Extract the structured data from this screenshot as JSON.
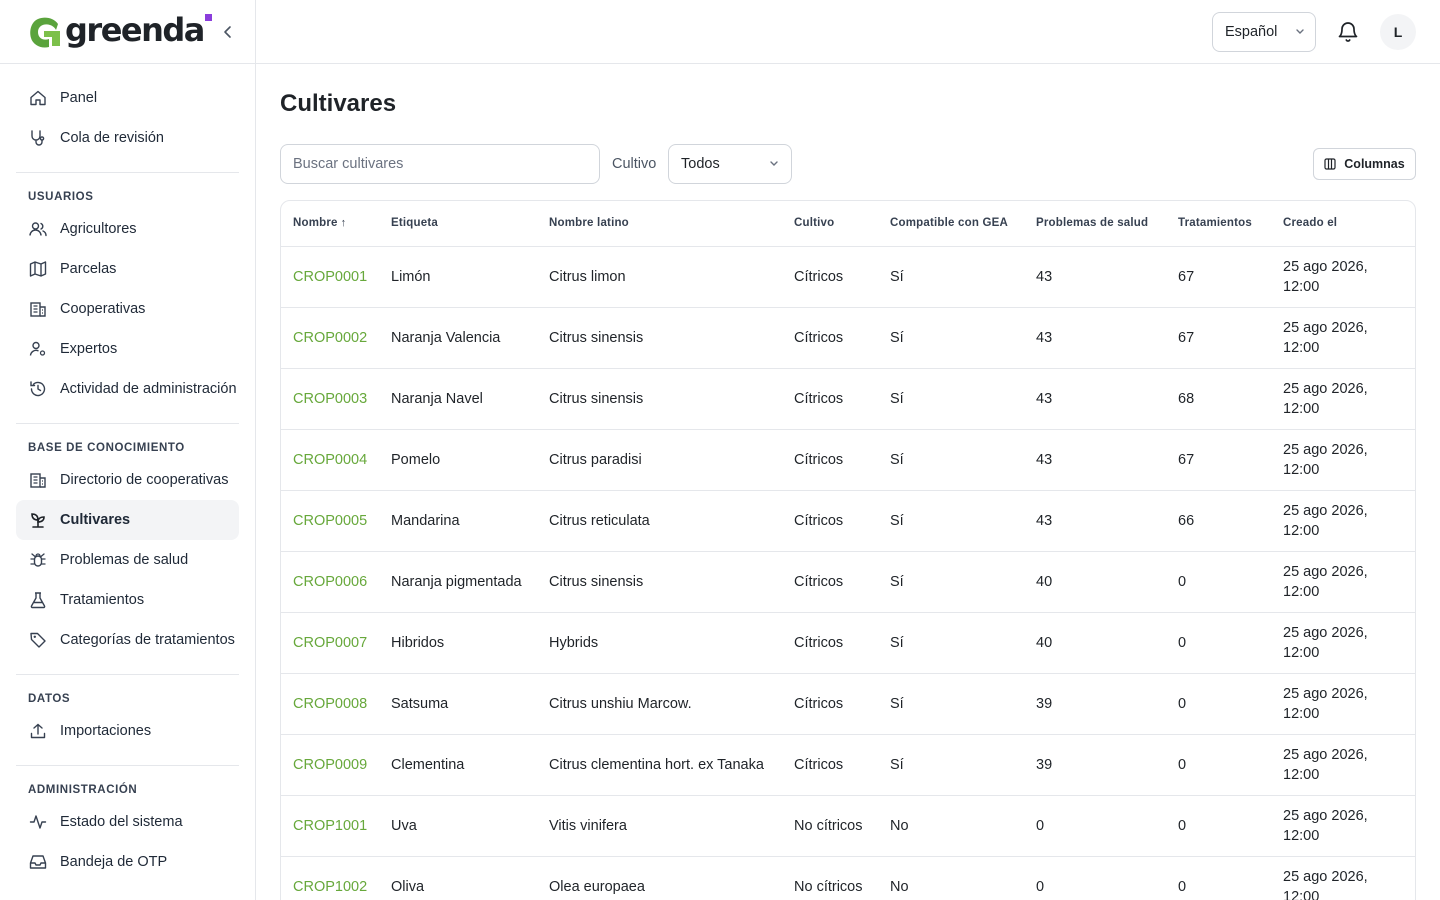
{
  "brand": {
    "name": "greenda",
    "accent": "#8b3ddc",
    "logo_green": "#5aa33c"
  },
  "sidebar": {
    "top_items": [
      {
        "label": "Panel",
        "icon": "home-icon"
      },
      {
        "label": "Cola de revisión",
        "icon": "stethoscope-icon"
      }
    ],
    "groups": [
      {
        "title": "USUARIOS",
        "items": [
          {
            "label": "Agricultores",
            "icon": "users-icon"
          },
          {
            "label": "Parcelas",
            "icon": "map-icon"
          },
          {
            "label": "Cooperativas",
            "icon": "building-icon"
          },
          {
            "label": "Expertos",
            "icon": "user-cog-icon"
          },
          {
            "label": "Actividad de administración",
            "icon": "history-icon"
          }
        ]
      },
      {
        "title": "BASE DE CONOCIMIENTO",
        "items": [
          {
            "label": "Directorio de cooperativas",
            "icon": "building-icon"
          },
          {
            "label": "Cultivares",
            "icon": "sprout-icon",
            "active": true
          },
          {
            "label": "Problemas de salud",
            "icon": "bug-icon"
          },
          {
            "label": "Tratamientos",
            "icon": "flask-icon"
          },
          {
            "label": "Categorías de tratamientos",
            "icon": "tag-icon"
          }
        ]
      },
      {
        "title": "DATOS",
        "items": [
          {
            "label": "Importaciones",
            "icon": "upload-icon"
          }
        ]
      },
      {
        "title": "ADMINISTRACIÓN",
        "items": [
          {
            "label": "Estado del sistema",
            "icon": "activity-icon"
          },
          {
            "label": "Bandeja de OTP",
            "icon": "inbox-icon"
          }
        ]
      }
    ]
  },
  "header": {
    "language": "Español",
    "avatar_initial": "L"
  },
  "page": {
    "title": "Cultivares",
    "search_placeholder": "Buscar cultivares",
    "filter_label": "Cultivo",
    "filter_value": "Todos",
    "columns_button": "Columnas"
  },
  "table": {
    "columns": [
      "Nombre",
      "Etiqueta",
      "Nombre latino",
      "Cultivo",
      "Compatible con GEA",
      "Problemas de salud",
      "Tratamientos",
      "Creado el"
    ],
    "sort_indicator": "↑",
    "rows": [
      [
        "CROP0001",
        "Limón",
        "Citrus limon",
        "Cítricos",
        "Sí",
        "43",
        "67",
        "25 ago 2026, 12:00"
      ],
      [
        "CROP0002",
        "Naranja Valencia",
        "Citrus sinensis",
        "Cítricos",
        "Sí",
        "43",
        "67",
        "25 ago 2026, 12:00"
      ],
      [
        "CROP0003",
        "Naranja Navel",
        "Citrus sinensis",
        "Cítricos",
        "Sí",
        "43",
        "68",
        "25 ago 2026, 12:00"
      ],
      [
        "CROP0004",
        "Pomelo",
        "Citrus paradisi",
        "Cítricos",
        "Sí",
        "43",
        "67",
        "25 ago 2026, 12:00"
      ],
      [
        "CROP0005",
        "Mandarina",
        "Citrus reticulata",
        "Cítricos",
        "Sí",
        "43",
        "66",
        "25 ago 2026, 12:00"
      ],
      [
        "CROP0006",
        "Naranja pigmentada",
        "Citrus sinensis",
        "Cítricos",
        "Sí",
        "40",
        "0",
        "25 ago 2026, 12:00"
      ],
      [
        "CROP0007",
        "Hibridos",
        "Hybrids",
        "Cítricos",
        "Sí",
        "40",
        "0",
        "25 ago 2026, 12:00"
      ],
      [
        "CROP0008",
        "Satsuma",
        "Citrus unshiu Marcow.",
        "Cítricos",
        "Sí",
        "39",
        "0",
        "25 ago 2026, 12:00"
      ],
      [
        "CROP0009",
        "Clementina",
        "Citrus clementina hort. ex Tanaka",
        "Cítricos",
        "Sí",
        "39",
        "0",
        "25 ago 2026, 12:00"
      ],
      [
        "CROP1001",
        "Uva",
        "Vitis vinifera",
        "No cítricos",
        "No",
        "0",
        "0",
        "25 ago 2026, 12:00"
      ],
      [
        "CROP1002",
        "Oliva",
        "Olea europaea",
        "No cítricos",
        "No",
        "0",
        "0",
        "25 ago 2026, 12:00"
      ]
    ]
  }
}
